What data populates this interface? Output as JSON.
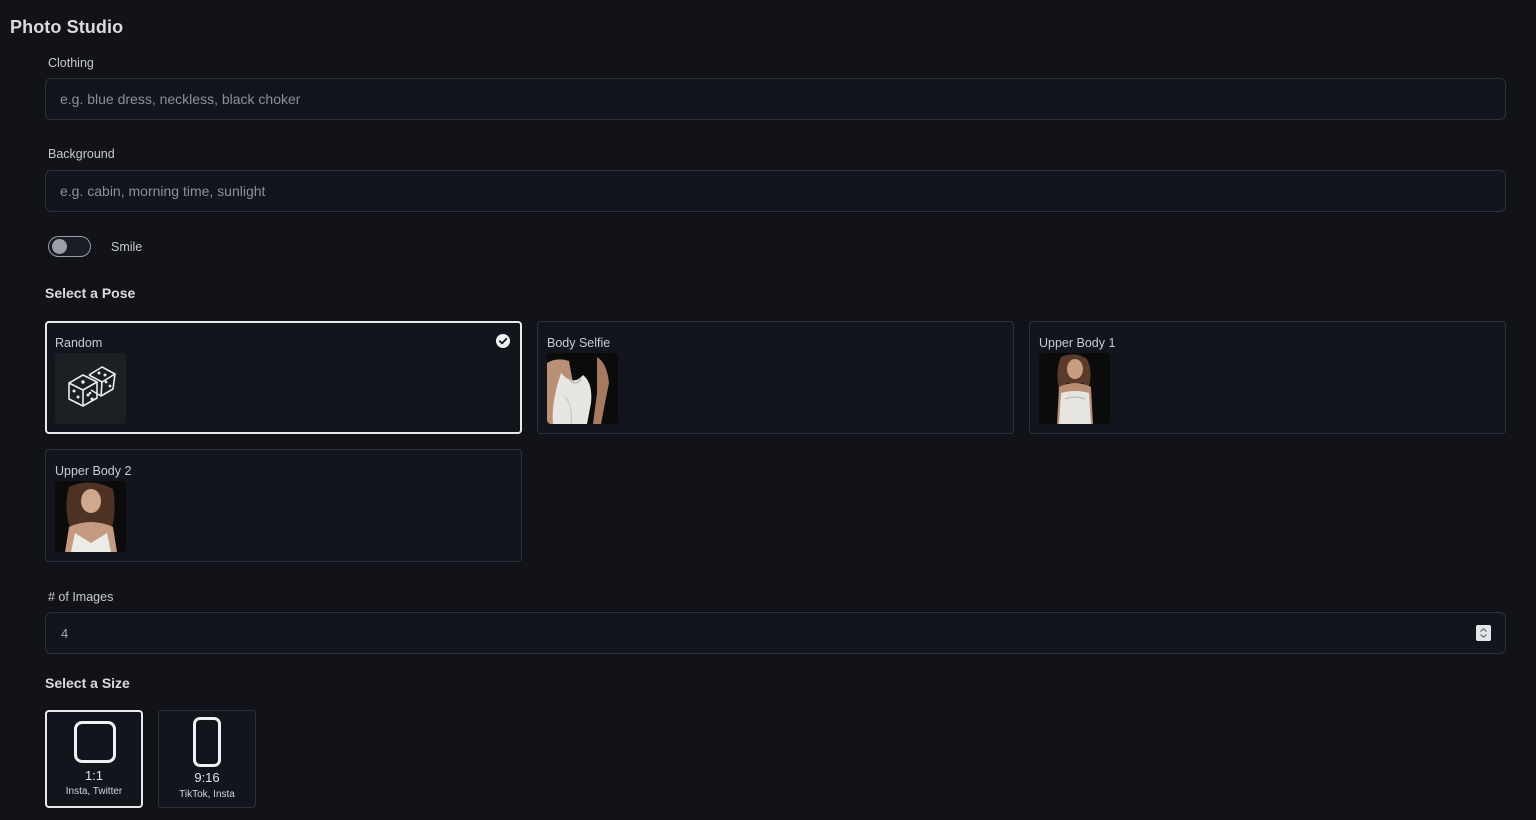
{
  "app": {
    "title": "Photo Studio"
  },
  "clothing": {
    "label": "Clothing",
    "placeholder": "e.g. blue dress, neckless, black choker",
    "value": ""
  },
  "background": {
    "label": "Background",
    "placeholder": "e.g. cabin, morning time, sunlight",
    "value": ""
  },
  "smile": {
    "label": "Smile",
    "enabled": false
  },
  "pose": {
    "heading": "Select a Pose",
    "options": [
      {
        "label": "Random",
        "icon": "dice-icon",
        "selected": true
      },
      {
        "label": "Body Selfie",
        "icon": "photo-thumbnail",
        "selected": false
      },
      {
        "label": "Upper Body 1",
        "icon": "photo-thumbnail",
        "selected": false
      },
      {
        "label": "Upper Body 2",
        "icon": "photo-thumbnail",
        "selected": false
      }
    ]
  },
  "images": {
    "label": "# of Images",
    "value": "4"
  },
  "size": {
    "heading": "Select a Size",
    "options": [
      {
        "ratio": "1:1",
        "desc": "Insta, Twitter",
        "selected": true
      },
      {
        "ratio": "9:16",
        "desc": "TikTok, Insta",
        "selected": false
      }
    ]
  },
  "colors": {
    "background": "#111318",
    "border": "#2a3140",
    "selected_border": "#e8e9ec",
    "text": "#d7d9de"
  }
}
